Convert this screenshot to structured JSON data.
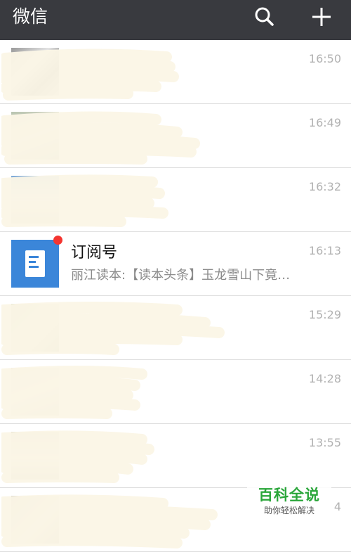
{
  "header": {
    "title": "微信",
    "search_icon": "search-icon",
    "add_icon": "plus-icon",
    "background": "#393a3f"
  },
  "chats": [
    {
      "time": "16:50",
      "redacted": true
    },
    {
      "time": "16:49",
      "redacted": true
    },
    {
      "time": "16:32",
      "redacted": true
    },
    {
      "name": "订阅号",
      "preview": "丽江读本:【读本头条】玉龙雪山下竟…",
      "time": "16:13",
      "unread_dot": true,
      "avatar_icon": "document-icon",
      "avatar_color": "#3b86d9"
    },
    {
      "time": "15:29",
      "redacted": true
    },
    {
      "time": "14:28",
      "redacted": true
    },
    {
      "time": "13:55",
      "redacted": true
    },
    {
      "time": "4",
      "redacted": true
    }
  ],
  "watermark": {
    "title": "百科全说",
    "subtitle": "助你轻松解决",
    "color": "#2aa63a"
  },
  "colors": {
    "redaction": "#fbf6e6",
    "unread_dot": "#f43530"
  }
}
